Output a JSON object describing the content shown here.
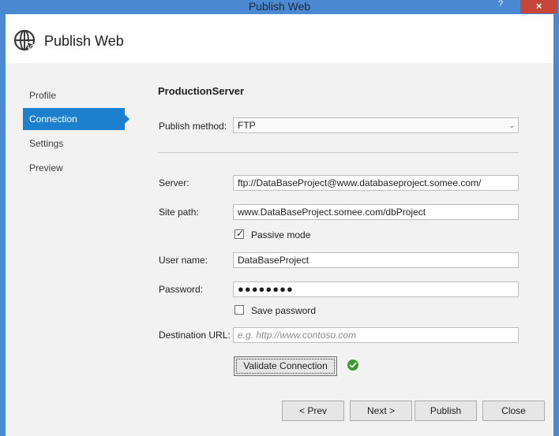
{
  "window": {
    "title": "Publish Web",
    "help_icon": "question-icon",
    "close_glyph": "×"
  },
  "header": {
    "title": "Publish Web",
    "icon": "globe-icon"
  },
  "nav": {
    "items": [
      {
        "label": "Profile"
      },
      {
        "label": "Connection"
      },
      {
        "label": "Settings"
      },
      {
        "label": "Preview"
      }
    ],
    "active_index": 1
  },
  "form": {
    "profile_name": "ProductionServer",
    "publish_method": {
      "label": "Publish method:",
      "value": "FTP"
    },
    "server": {
      "label": "Server:",
      "value": "ftp://DataBaseProject@www.databaseproject.somee.com/"
    },
    "site_path": {
      "label": "Site path:",
      "value": "www.DataBaseProject.somee.com/dbProject"
    },
    "passive_mode": {
      "label": "Passive mode",
      "checked": true
    },
    "user_name": {
      "label": "User name:",
      "value": "DataBaseProject"
    },
    "password": {
      "label": "Password:",
      "value": "●●●●●●●●"
    },
    "save_password": {
      "label": "Save password",
      "checked": false
    },
    "destination_url": {
      "label": "Destination URL:",
      "placeholder": "e.g. http://www.contoso.com"
    },
    "validate_label": "Validate Connection",
    "validation_status": "success"
  },
  "buttons": {
    "prev": "< Prev",
    "next": "Next >",
    "publish": "Publish",
    "close": "Close"
  },
  "colors": {
    "accent": "#1c80cf",
    "title_bar": "#4b8ad2",
    "close_button": "#c7463a",
    "success": "#3a9a2e"
  }
}
